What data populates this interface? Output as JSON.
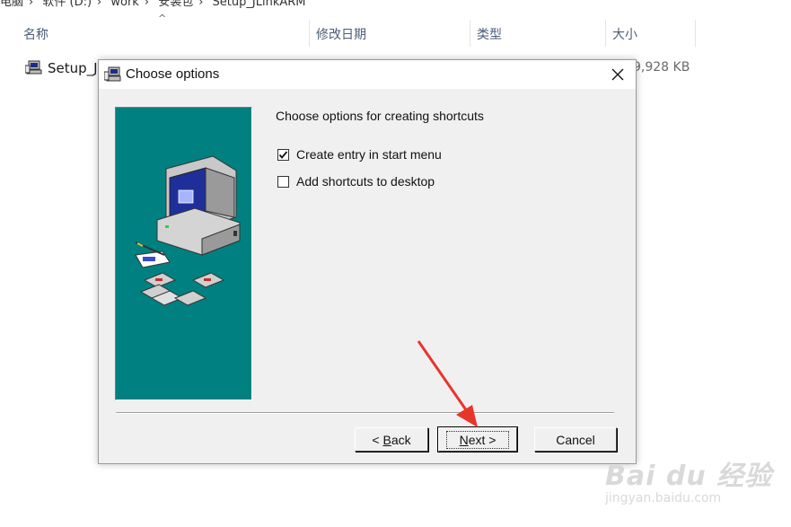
{
  "explorer": {
    "breadcrumb": [
      "电脑",
      "软件 (D:)",
      "work",
      "安装包",
      "Setup_JLinkARM"
    ],
    "columns": [
      "名称",
      "修改日期",
      "类型",
      "大小"
    ],
    "file": {
      "name": "Setup_J",
      "size": "9,928 KB"
    }
  },
  "dialog": {
    "title": "Choose options",
    "heading": "Choose options for creating shortcuts",
    "options": [
      {
        "label": "Create entry in start menu",
        "checked": true
      },
      {
        "label": "Add shortcuts to desktop",
        "checked": false
      }
    ],
    "buttons": {
      "back": {
        "prefix": "< ",
        "mnemonic": "B",
        "rest": "ack"
      },
      "next": {
        "mnemonic": "N",
        "rest": "ext >"
      },
      "cancel": "Cancel"
    }
  },
  "watermark": {
    "brand": "Bai du 经验",
    "url": "jingyan.baidu.com"
  },
  "colors": {
    "side_panel": "#008080",
    "arrow": "#e8352a",
    "dialog_bg": "#f0f0f0"
  }
}
